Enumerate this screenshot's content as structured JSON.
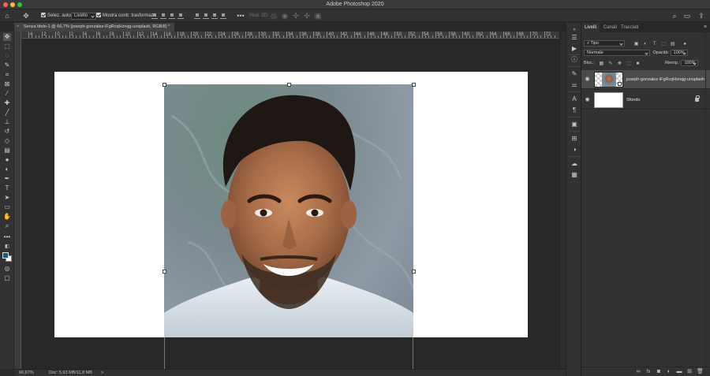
{
  "window": {
    "title": "Adobe Photoshop 2020"
  },
  "options_bar": {
    "auto_select_label": "Selez. auto:",
    "auto_select_value": "Livello",
    "show_transform_label": "Mostra contr. trasformaz.",
    "mode_3d_label": "Mod. 3D:"
  },
  "document": {
    "tab_title": "Senza titolo-1 @ 66,7% (joseph-gonzalez-iFgRcqHznqg-unsplash, RGB/8) *"
  },
  "ruler": {
    "labels": [
      "4",
      "2",
      "0",
      "2",
      "4",
      "6",
      "8",
      "10",
      "12",
      "14",
      "16",
      "18",
      "20",
      "22",
      "24",
      "26",
      "28",
      "30",
      "32",
      "34",
      "36",
      "38",
      "40",
      "42",
      "44",
      "46",
      "48",
      "50",
      "52",
      "54",
      "56",
      "58",
      "60",
      "62",
      "64",
      "66",
      "68",
      "70",
      "72"
    ]
  },
  "status_bar": {
    "zoom": "66,67%",
    "doc_info": "Doc: 5,93 MB/11,8 MB",
    "arrow": ">"
  },
  "colors": {
    "foreground": "#1a5a7e",
    "background": "#ffffff",
    "accent": "#4b4b4b"
  },
  "layers_panel": {
    "tabs": [
      {
        "label": "Livelli"
      },
      {
        "label": "Canali"
      },
      {
        "label": "Tracciati"
      }
    ],
    "filter_kind": "Tipo",
    "blend_mode": "Normale",
    "opacity_label": "Opacità:",
    "opacity_value": "100%",
    "lock_label": "Bloc.:",
    "fill_label": "Riemp.:",
    "fill_value": "100%",
    "layers": [
      {
        "name": "joseph-gonzalez-iFgRcqHznqg-unsplash"
      },
      {
        "name": "Sfondo"
      }
    ]
  }
}
